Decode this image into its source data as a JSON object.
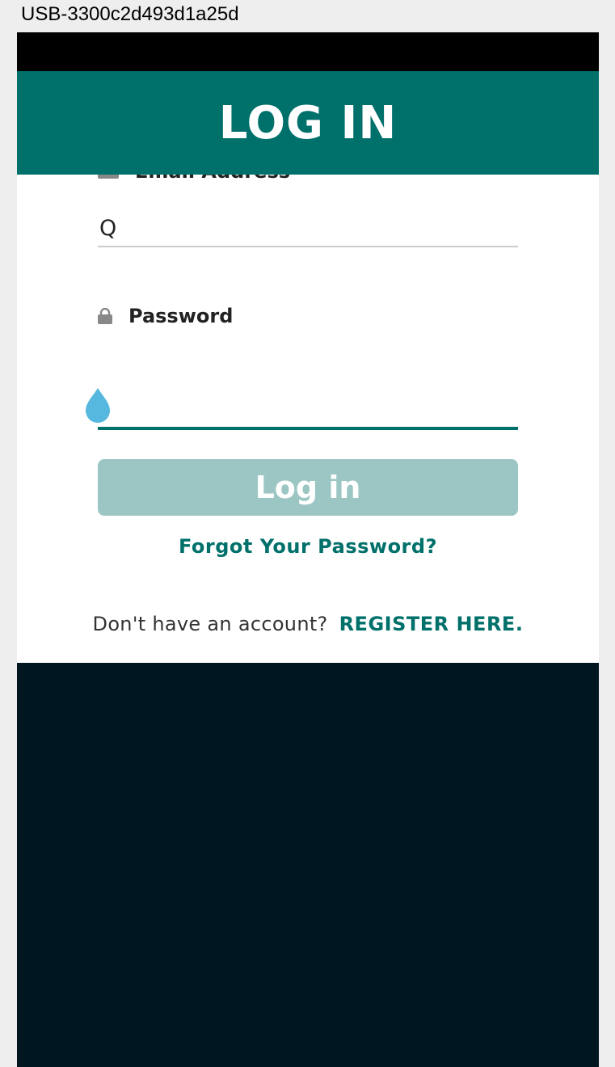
{
  "device_label": "USB-3300c2d493d1a25d",
  "header": {
    "title": "LOG IN"
  },
  "form": {
    "email": {
      "label": "Email Address",
      "value": "Q",
      "icon": "email-icon"
    },
    "password": {
      "label": "Password",
      "value": "",
      "icon": "lock-icon"
    },
    "login_button": "Log in",
    "forgot_link": "Forgot Your Password?",
    "register_prompt": "Don't have an account?",
    "register_link": "REGISTER HERE."
  },
  "colors": {
    "brand": "#00706b",
    "button_disabled": "#9cc6c3",
    "footer": "#001620",
    "status_bar": "#000000",
    "cursor_handle": "#56b8de"
  }
}
